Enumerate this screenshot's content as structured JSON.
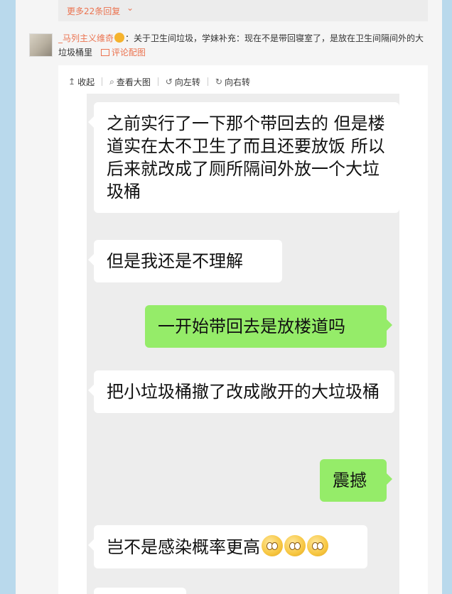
{
  "more_replies": {
    "label": "更多22条回复",
    "icon": "chevron-down-icon"
  },
  "comment": {
    "username": "_马列主义维奇",
    "separator": "：",
    "text": "关于卫生间垃圾，学妹补充：现在不是带回寝室了，是放在卫生间隔间外的大垃圾桶里",
    "view_pic_label": "评论配图"
  },
  "toolbar": {
    "collapse": "收起",
    "view_large": "查看大图",
    "rotate_left": "向左转",
    "rotate_right": "向右转"
  },
  "chat": {
    "messages": [
      {
        "side": "left",
        "text": "之前实行了一下那个带回去的 但是楼道实在太不卫生了而且还要放饭 所以后来就改成了厕所隔间外放一个大垃圾桶"
      },
      {
        "side": "left",
        "text": "但是我还是不理解"
      },
      {
        "side": "right",
        "text": "一开始带回去是放楼道吗"
      },
      {
        "side": "left",
        "text": "把小垃圾桶撤了改成敞开的大垃圾桶"
      },
      {
        "side": "right",
        "text": "震撼"
      },
      {
        "side": "left",
        "text": "岂不是感染概率更高",
        "emojis": [
          "surprised-face-emoji",
          "surprised-face-emoji",
          "surprised-face-emoji"
        ]
      }
    ]
  },
  "colors": {
    "accent": "#eb7350",
    "chat_bg": "#ededed",
    "bubble_right": "#95ec69",
    "bubble_left": "#ffffff"
  }
}
